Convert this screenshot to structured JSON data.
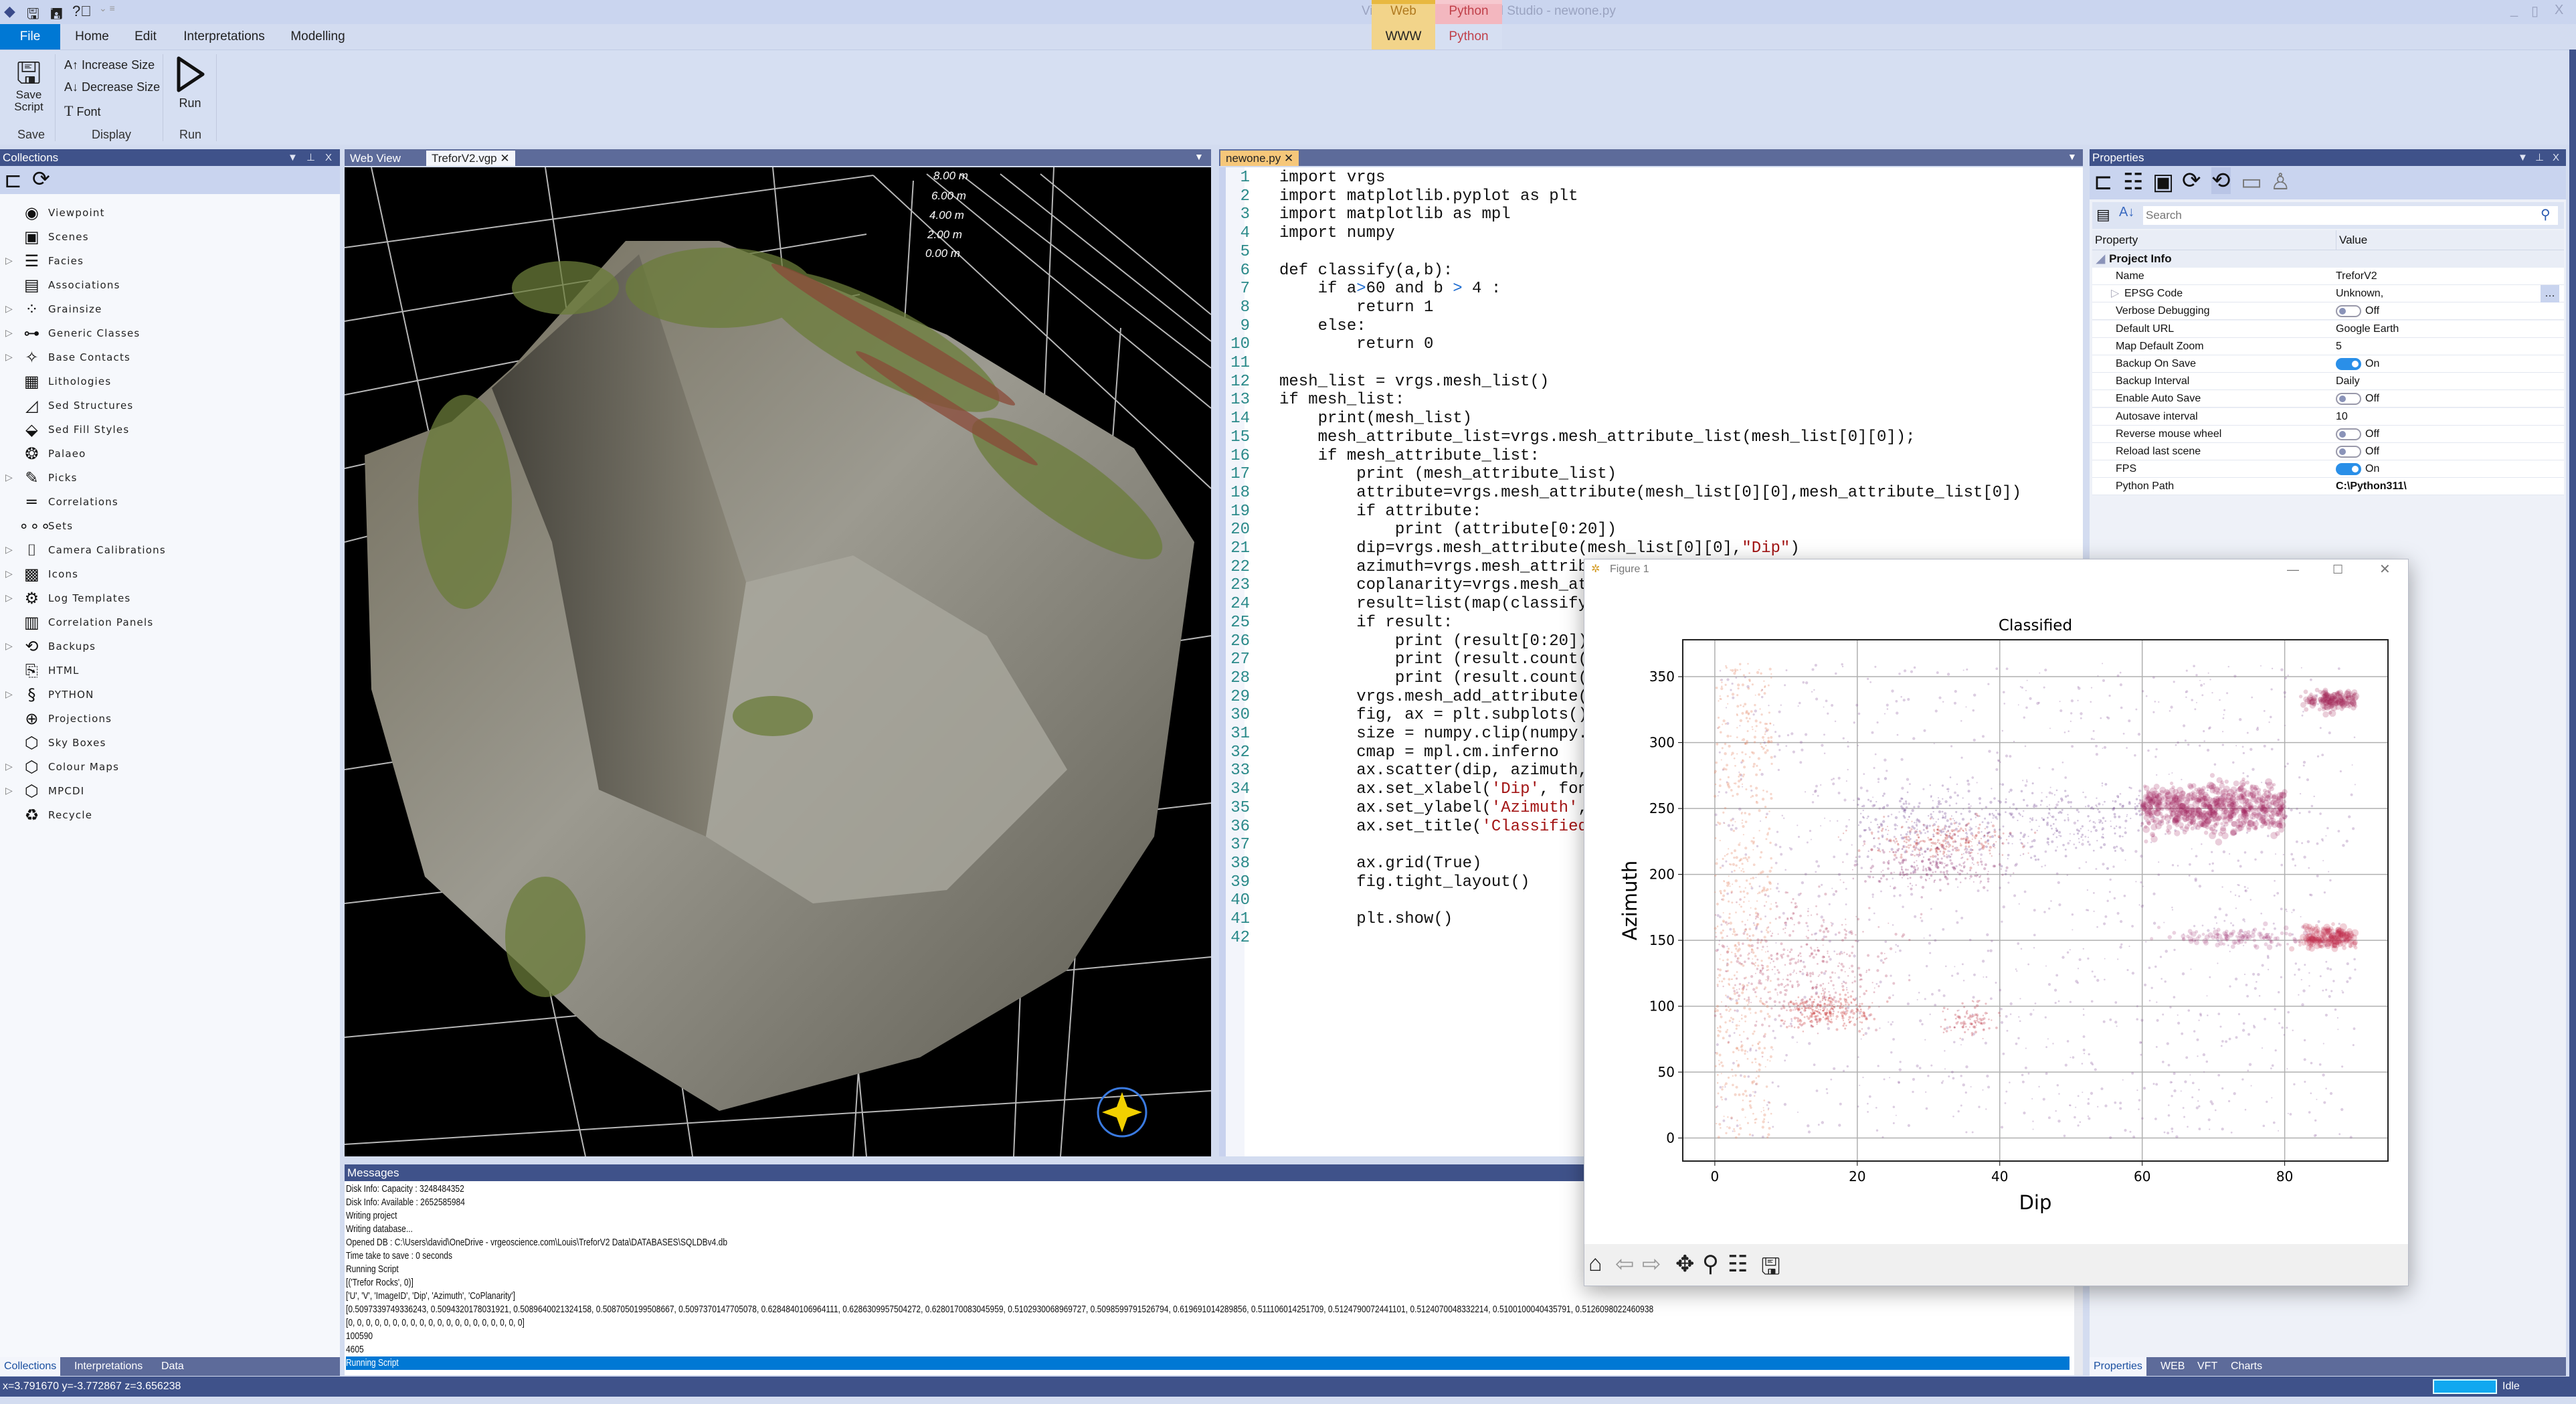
{
  "window": {
    "title": "Virtual Reality Geological Studio - newone.py"
  },
  "context_tabs": {
    "web": "Web",
    "python": "Python"
  },
  "ribbon_tabs": [
    "File",
    "Home",
    "Edit",
    "Interpretations",
    "Modelling",
    "WWW",
    "Python"
  ],
  "ribbon": {
    "save_script": "Save\nScript",
    "increase_size": "Increase Size",
    "decrease_size": "Decrease Size",
    "font": "Font",
    "run": "Run",
    "groups": {
      "save": "Save",
      "display": "Display",
      "run": "Run"
    }
  },
  "collections": {
    "title": "Collections",
    "items": [
      {
        "label": "Viewpoint",
        "icon": "eye-icon",
        "glyph": "◉",
        "expandable": false
      },
      {
        "label": "Scenes",
        "icon": "image-icon",
        "glyph": "▣",
        "expandable": false
      },
      {
        "label": "Facies",
        "icon": "list-icon",
        "glyph": "☰",
        "expandable": true
      },
      {
        "label": "Associations",
        "icon": "list-box-icon",
        "glyph": "▤",
        "expandable": false
      },
      {
        "label": "Grainsize",
        "icon": "dots-icon",
        "glyph": "⁘",
        "expandable": true
      },
      {
        "label": "Generic Classes",
        "icon": "hierarchy-icon",
        "glyph": "⊶",
        "expandable": true
      },
      {
        "label": "Base Contacts",
        "icon": "contact-icon",
        "glyph": "✧",
        "expandable": true
      },
      {
        "label": "Lithologies",
        "icon": "brick-icon",
        "glyph": "▦",
        "expandable": false
      },
      {
        "label": "Sed Structures",
        "icon": "structure-icon",
        "glyph": "◿",
        "expandable": false
      },
      {
        "label": "Sed Fill Styles",
        "icon": "fill-icon",
        "glyph": "⬙",
        "expandable": false
      },
      {
        "label": "Palaeo",
        "icon": "trilobite-icon",
        "glyph": "❂",
        "expandable": false
      },
      {
        "label": "Picks",
        "icon": "pencil-icon",
        "glyph": "✎",
        "expandable": true
      },
      {
        "label": "Correlations",
        "icon": "lines-icon",
        "glyph": "═",
        "expandable": false
      },
      {
        "label": "Sets",
        "icon": "sets-icon",
        "glyph": "∘∘∘",
        "expandable": false
      },
      {
        "label": "Camera Calibrations",
        "icon": "camera-icon",
        "glyph": "⌷",
        "expandable": true
      },
      {
        "label": "Icons",
        "icon": "icons-icon",
        "glyph": "▩",
        "expandable": true
      },
      {
        "label": "Log Templates",
        "icon": "gear-icon",
        "glyph": "⚙",
        "expandable": true
      },
      {
        "label": "Correlation Panels",
        "icon": "map-icon",
        "glyph": "▥",
        "expandable": false
      },
      {
        "label": "Backups",
        "icon": "backup-icon",
        "glyph": "⟲",
        "expandable": true
      },
      {
        "label": "HTML",
        "icon": "html-file-icon",
        "glyph": "⎘",
        "expandable": false
      },
      {
        "label": "PYTHON",
        "icon": "python-icon",
        "glyph": "§",
        "expandable": true
      },
      {
        "label": "Projections",
        "icon": "globe-icon",
        "glyph": "⊕",
        "expandable": false
      },
      {
        "label": "Sky Boxes",
        "icon": "cube-icon",
        "glyph": "⬡",
        "expandable": false
      },
      {
        "label": "Colour Maps",
        "icon": "cube-icon",
        "glyph": "⬡",
        "expandable": true
      },
      {
        "label": "MPCDI",
        "icon": "cube-icon",
        "glyph": "⬡",
        "expandable": true
      },
      {
        "label": "Recycle",
        "icon": "recycle-icon",
        "glyph": "♻",
        "expandable": false
      }
    ]
  },
  "doc_tabs": {
    "web_view": "Web View",
    "trefor": "TreforV2.vgp",
    "newone": "newone.py"
  },
  "viewport": {
    "scale_labels": [
      "8.00 m",
      "6.00 m",
      "4.00 m",
      "2.00 m",
      "0.00 m"
    ]
  },
  "code": {
    "lines": [
      "import vrgs",
      "import matplotlib.pyplot as plt",
      "import matplotlib as mpl",
      "import numpy",
      "",
      "def classify(a,b):",
      "    if a>60 and b > 4 :",
      "        return 1",
      "    else:",
      "        return 0",
      "",
      "mesh_list = vrgs.mesh_list()",
      "if mesh_list:",
      "    print(mesh_list)",
      "    mesh_attribute_list=vrgs.mesh_attribute_list(mesh_list[0][0]);",
      "    if mesh_attribute_list:",
      "        print (mesh_attribute_list)",
      "        attribute=vrgs.mesh_attribute(mesh_list[0][0],mesh_attribute_list[0])",
      "        if attribute:",
      "            print (attribute[0:20])",
      "        dip=vrgs.mesh_attribute(mesh_list[0][0],\"Dip\")",
      "        azimuth=vrgs.mesh_attrib",
      "        coplanarity=vrgs.mesh_at",
      "        result=list(map(classify",
      "        if result:",
      "            print (result[0:20])",
      "            print (result.count(",
      "            print (result.count(",
      "        vrgs.mesh_add_attribute(",
      "        fig, ax = plt.subplots()",
      "        size = numpy.clip(numpy.",
      "        cmap = mpl.cm.inferno",
      "        ax.scatter(dip, azimuth,",
      "        ax.set_xlabel('Dip', fon",
      "        ax.set_ylabel('Azimuth',",
      "        ax.set_title('Classified",
      "",
      "        ax.grid(True)",
      "        fig.tight_layout()",
      "",
      "        plt.show()",
      ""
    ]
  },
  "properties": {
    "title": "Properties",
    "search_placeholder": "Search",
    "col_property": "Property",
    "col_value": "Value",
    "category": "Project Info",
    "rows": [
      {
        "key": "Name",
        "value": "TreforV2"
      },
      {
        "key": "EPSG Code",
        "value": "Unknown,",
        "expandable": true
      },
      {
        "key": "Verbose Debugging",
        "value": "Off",
        "toggle": false
      },
      {
        "key": "Default URL",
        "value": "Google Earth"
      },
      {
        "key": "Map Default Zoom",
        "value": "5"
      },
      {
        "key": "Backup On Save",
        "value": "On",
        "toggle": true
      },
      {
        "key": "Backup Interval",
        "value": "Daily"
      },
      {
        "key": "Enable Auto Save",
        "value": "Off",
        "toggle": false
      },
      {
        "key": "Autosave interval",
        "value": "10"
      },
      {
        "key": "Reverse mouse wheel",
        "value": "Off",
        "toggle": false
      },
      {
        "key": "Reload last scene",
        "value": "Off",
        "toggle": false
      },
      {
        "key": "FPS",
        "value": "On",
        "toggle": true
      },
      {
        "key": "Python Path",
        "value": "C:\\Python311\\",
        "bold": true
      }
    ]
  },
  "messages": {
    "title": "Messages",
    "lines": [
      "Disk Info: Capacity : 3248484352",
      "Disk Info: Available : 2652585984",
      "Writing project",
      "Writing database...",
      "Opened DB : C:\\Users\\david\\OneDrive - vrgeoscience.com\\Louis\\TreforV2 Data\\DATABASES\\SQLDBv4.db",
      "Time take to save : 0 seconds",
      "Running Script",
      "[('Trefor Rocks', 0)]",
      "['U', 'V', 'ImageID', 'Dip', 'Azimuth', 'CoPlanarity']",
      "[0.5097339749336243, 0.5094320178031921, 0.5089640021324158, 0.5087050199508667, 0.5097370147705078, 0.6284840106964111, 0.6286309957504272, 0.6280170083045959, 0.5102930068969727, 0.5098599791526794, 0.619691014289856, 0.511106014251709, 0.5124790072441101, 0.5124070048332214, 0.5100100040435791, 0.5126098022460938",
      "[0, 0, 0, 0, 0, 0, 0, 0, 0, 0, 0, 0, 0, 0, 0, 0, 0, 0, 0, 0]",
      "100590",
      "4605",
      "Running Script"
    ]
  },
  "bottom_tabs_left": [
    "Collections",
    "Interpretations",
    "Data"
  ],
  "bottom_tabs_right": [
    "Properties",
    "WEB",
    "VFT",
    "Charts"
  ],
  "status": {
    "coords": "x=3.791670 y=-3.772867 z=3.656238",
    "state": "Idle"
  },
  "figure": {
    "window_title": "Figure 1"
  },
  "chart_data": {
    "type": "scatter",
    "title": "Classified",
    "xlabel": "Dip",
    "ylabel": "Azimuth",
    "xlim": [
      -4.5,
      94.5
    ],
    "ylim": [
      -17.5,
      378
    ],
    "xticks": [
      0,
      20,
      40,
      60,
      80
    ],
    "yticks": [
      0,
      50,
      100,
      150,
      200,
      250,
      300,
      350
    ],
    "grid": true,
    "colormap": "inferno",
    "density_clusters": [
      {
        "dip": [
          0,
          90
        ],
        "azimuth": [
          0,
          360
        ],
        "n": 1300,
        "color": "#8a5a9a",
        "dist": "uniform"
      },
      {
        "dip": [
          0,
          8
        ],
        "azimuth": [
          0,
          360
        ],
        "n": 600,
        "color": "#e07a55",
        "dist": "uniform"
      },
      {
        "dip": 12,
        "azimuth": 130,
        "sd": [
          6,
          25
        ],
        "n": 450,
        "color": "#b04060"
      },
      {
        "dip": 16,
        "azimuth": 97,
        "sd": [
          3,
          7
        ],
        "n": 260,
        "color": "#c83030"
      },
      {
        "dip": 32,
        "azimuth": 226,
        "sd": [
          5,
          7
        ],
        "n": 260,
        "color": "#c03838"
      },
      {
        "dip": 30,
        "azimuth": 205,
        "sd": [
          5,
          8
        ],
        "n": 220,
        "color": "#8a2a6a"
      },
      {
        "dip": 36,
        "azimuth": 90,
        "sd": [
          2,
          6
        ],
        "n": 90,
        "color": "#b83040"
      },
      {
        "dip": [
          20,
          60
        ],
        "azimuth": 240,
        "sd": [
          0,
          14
        ],
        "n": 450,
        "color": "#6a3a8a",
        "dist": "band"
      },
      {
        "dip": [
          60,
          80
        ],
        "azimuth": 250,
        "sd": [
          0,
          9
        ],
        "n": 650,
        "color": "#a0205a",
        "dist": "band",
        "r": 4
      },
      {
        "dip": 87,
        "azimuth": 332,
        "sd": [
          2,
          4
        ],
        "n": 160,
        "color": "#a02050",
        "r": 4
      },
      {
        "dip": 87,
        "azimuth": 152,
        "sd": [
          2.5,
          4
        ],
        "n": 200,
        "color": "#c02848",
        "r": 4
      },
      {
        "dip": 74,
        "azimuth": 153,
        "sd": [
          5,
          3
        ],
        "n": 110,
        "color": "#a03070",
        "r": 3
      }
    ]
  }
}
